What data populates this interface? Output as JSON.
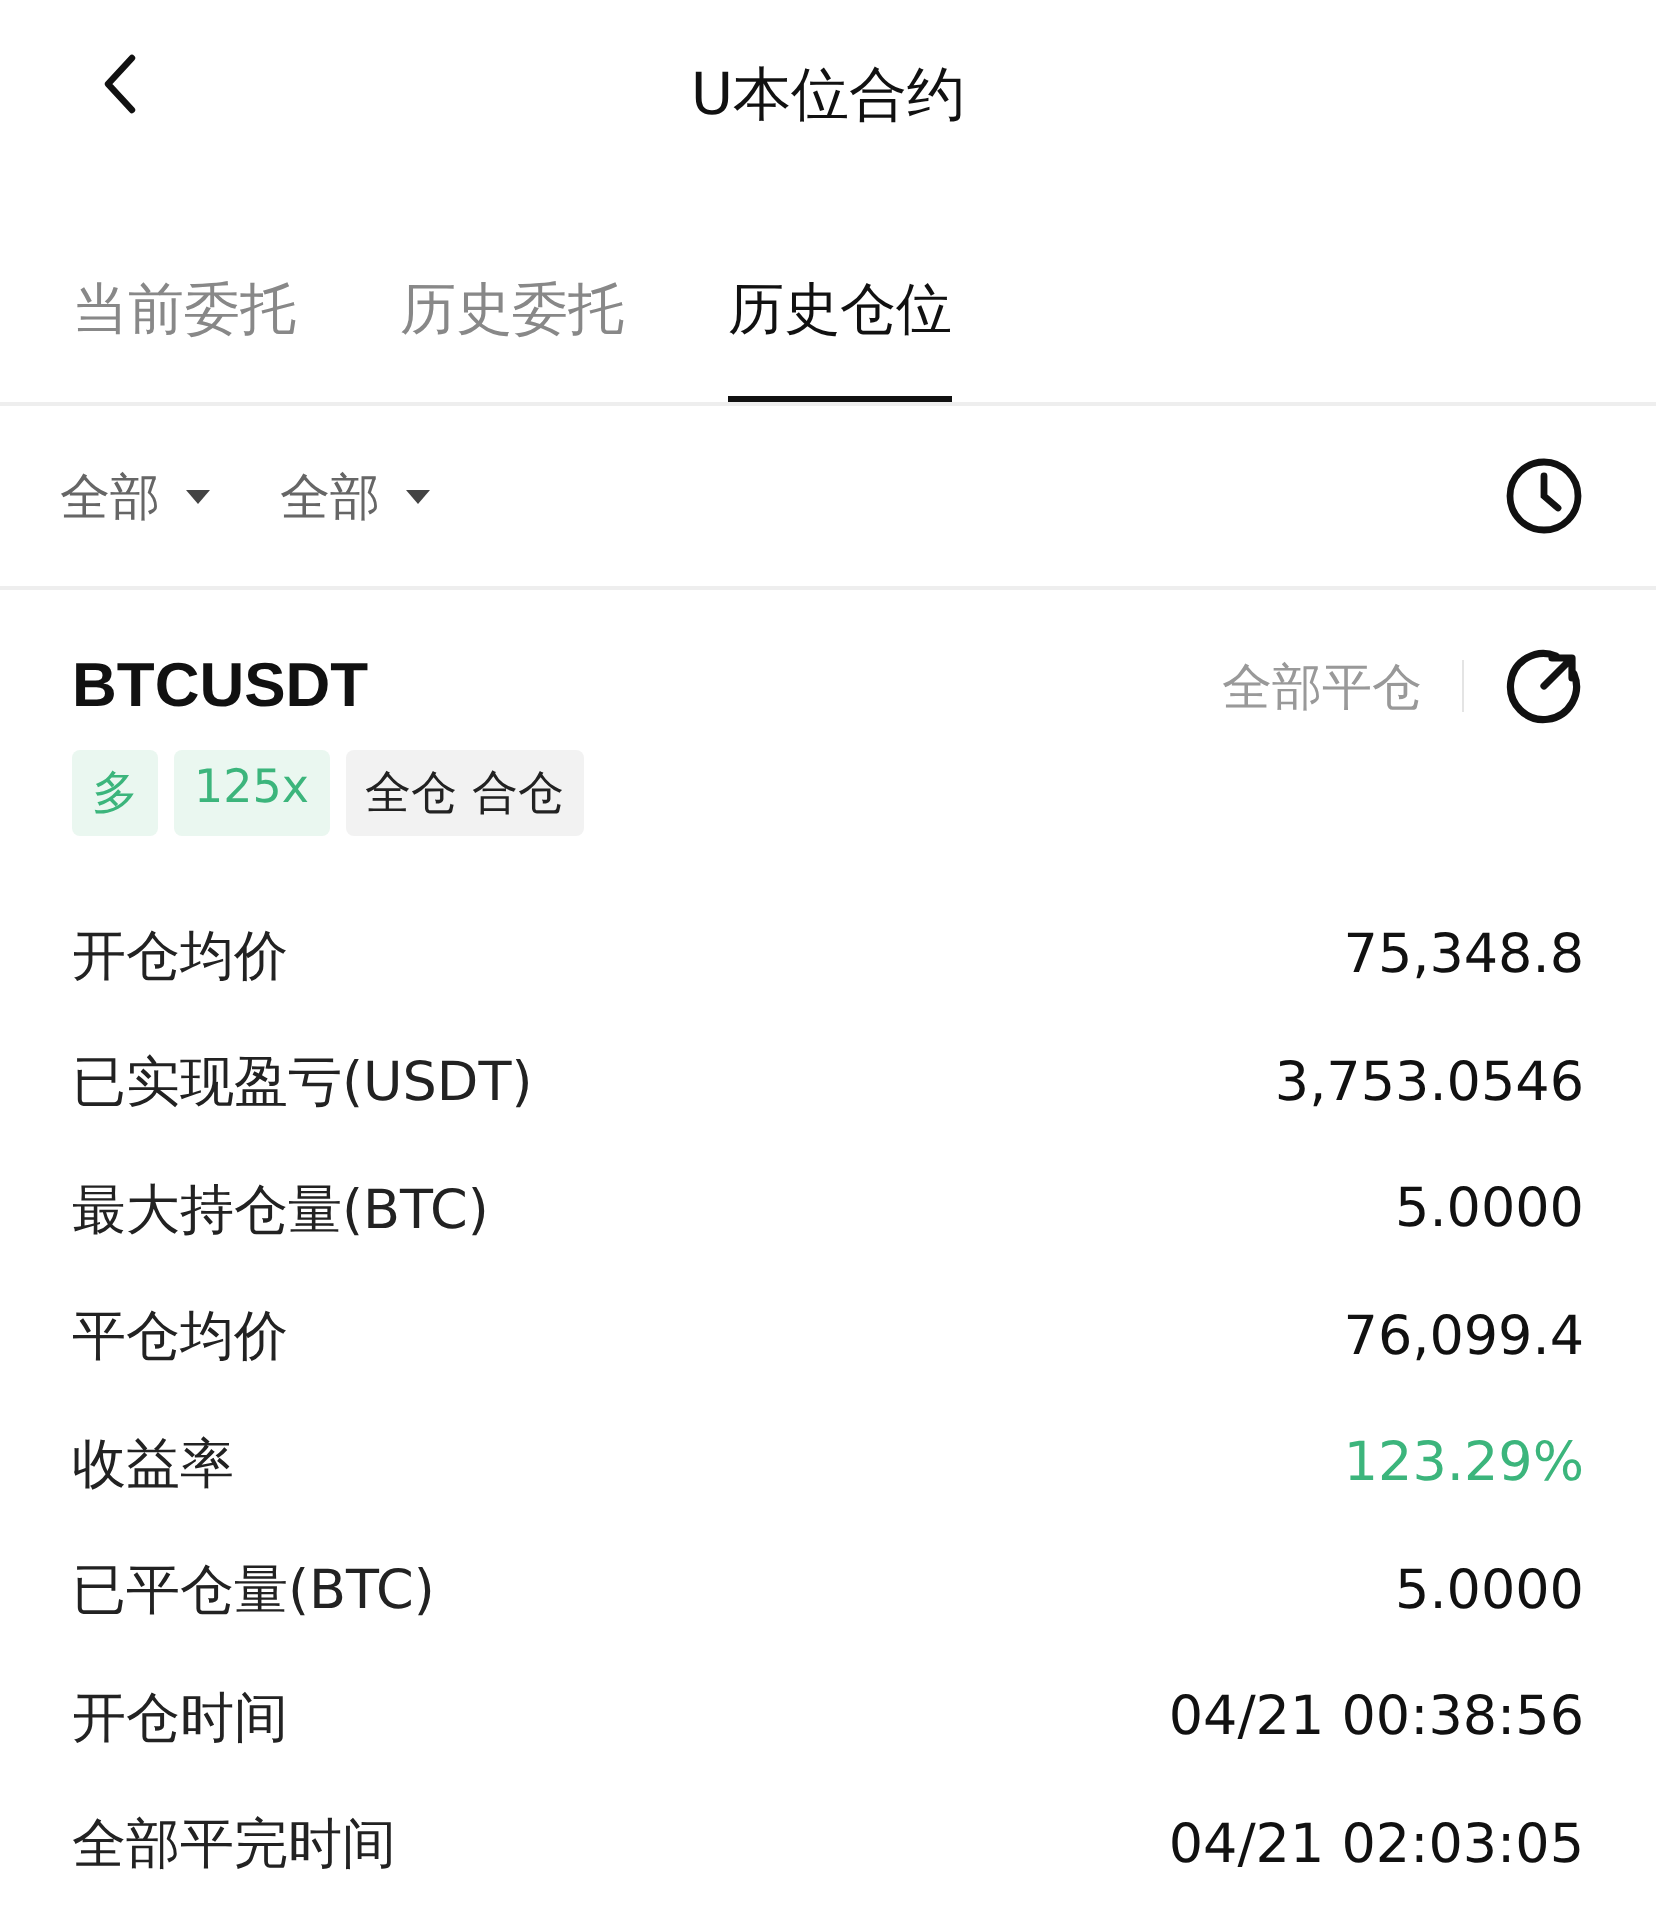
{
  "header": {
    "title": "U本位合约"
  },
  "tabs": [
    {
      "label": "当前委托",
      "selected": false
    },
    {
      "label": "历史委托",
      "selected": false
    },
    {
      "label": "历史仓位",
      "selected": true
    }
  ],
  "filters": [
    {
      "label": "全部"
    },
    {
      "label": "全部"
    }
  ],
  "position": {
    "symbol": "BTCUSDT",
    "close_all": "全部平仓",
    "tags": [
      {
        "kind": "side",
        "text": "多"
      },
      {
        "kind": "leverage",
        "text": "125x"
      },
      {
        "kind": "mode",
        "text": "全仓 合仓"
      }
    ],
    "rows": [
      {
        "label": "开仓均价",
        "value": "75,348.8",
        "positive": false
      },
      {
        "label": "已实现盈亏(USDT)",
        "value": "3,753.0546",
        "positive": false
      },
      {
        "label": "最大持仓量(BTC)",
        "value": "5.0000",
        "positive": false
      },
      {
        "label": "平仓均价",
        "value": "76,099.4",
        "positive": false
      },
      {
        "label": "收益率",
        "value": "123.29%",
        "positive": true
      },
      {
        "label": "已平仓量(BTC)",
        "value": "5.0000",
        "positive": false
      },
      {
        "label": "开仓时间",
        "value": "04/21 00:38:56",
        "positive": false
      },
      {
        "label": "全部平完时间",
        "value": "04/21 02:03:05",
        "positive": false
      }
    ]
  }
}
